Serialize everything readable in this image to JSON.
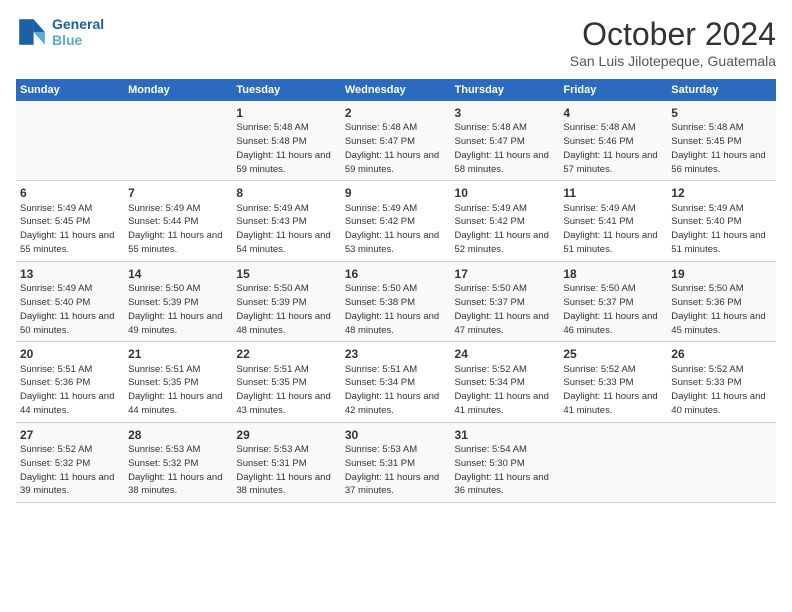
{
  "logo": {
    "line1": "General",
    "line2": "Blue"
  },
  "title": "October 2024",
  "subtitle": "San Luis Jilotepeque, Guatemala",
  "headers": [
    "Sunday",
    "Monday",
    "Tuesday",
    "Wednesday",
    "Thursday",
    "Friday",
    "Saturday"
  ],
  "weeks": [
    [
      {
        "day": "",
        "info": ""
      },
      {
        "day": "",
        "info": ""
      },
      {
        "day": "1",
        "info": "Sunrise: 5:48 AM\nSunset: 5:48 PM\nDaylight: 11 hours and 59 minutes."
      },
      {
        "day": "2",
        "info": "Sunrise: 5:48 AM\nSunset: 5:47 PM\nDaylight: 11 hours and 59 minutes."
      },
      {
        "day": "3",
        "info": "Sunrise: 5:48 AM\nSunset: 5:47 PM\nDaylight: 11 hours and 58 minutes."
      },
      {
        "day": "4",
        "info": "Sunrise: 5:48 AM\nSunset: 5:46 PM\nDaylight: 11 hours and 57 minutes."
      },
      {
        "day": "5",
        "info": "Sunrise: 5:48 AM\nSunset: 5:45 PM\nDaylight: 11 hours and 56 minutes."
      }
    ],
    [
      {
        "day": "6",
        "info": "Sunrise: 5:49 AM\nSunset: 5:45 PM\nDaylight: 11 hours and 55 minutes."
      },
      {
        "day": "7",
        "info": "Sunrise: 5:49 AM\nSunset: 5:44 PM\nDaylight: 11 hours and 55 minutes."
      },
      {
        "day": "8",
        "info": "Sunrise: 5:49 AM\nSunset: 5:43 PM\nDaylight: 11 hours and 54 minutes."
      },
      {
        "day": "9",
        "info": "Sunrise: 5:49 AM\nSunset: 5:42 PM\nDaylight: 11 hours and 53 minutes."
      },
      {
        "day": "10",
        "info": "Sunrise: 5:49 AM\nSunset: 5:42 PM\nDaylight: 11 hours and 52 minutes."
      },
      {
        "day": "11",
        "info": "Sunrise: 5:49 AM\nSunset: 5:41 PM\nDaylight: 11 hours and 51 minutes."
      },
      {
        "day": "12",
        "info": "Sunrise: 5:49 AM\nSunset: 5:40 PM\nDaylight: 11 hours and 51 minutes."
      }
    ],
    [
      {
        "day": "13",
        "info": "Sunrise: 5:49 AM\nSunset: 5:40 PM\nDaylight: 11 hours and 50 minutes."
      },
      {
        "day": "14",
        "info": "Sunrise: 5:50 AM\nSunset: 5:39 PM\nDaylight: 11 hours and 49 minutes."
      },
      {
        "day": "15",
        "info": "Sunrise: 5:50 AM\nSunset: 5:39 PM\nDaylight: 11 hours and 48 minutes."
      },
      {
        "day": "16",
        "info": "Sunrise: 5:50 AM\nSunset: 5:38 PM\nDaylight: 11 hours and 48 minutes."
      },
      {
        "day": "17",
        "info": "Sunrise: 5:50 AM\nSunset: 5:37 PM\nDaylight: 11 hours and 47 minutes."
      },
      {
        "day": "18",
        "info": "Sunrise: 5:50 AM\nSunset: 5:37 PM\nDaylight: 11 hours and 46 minutes."
      },
      {
        "day": "19",
        "info": "Sunrise: 5:50 AM\nSunset: 5:36 PM\nDaylight: 11 hours and 45 minutes."
      }
    ],
    [
      {
        "day": "20",
        "info": "Sunrise: 5:51 AM\nSunset: 5:36 PM\nDaylight: 11 hours and 44 minutes."
      },
      {
        "day": "21",
        "info": "Sunrise: 5:51 AM\nSunset: 5:35 PM\nDaylight: 11 hours and 44 minutes."
      },
      {
        "day": "22",
        "info": "Sunrise: 5:51 AM\nSunset: 5:35 PM\nDaylight: 11 hours and 43 minutes."
      },
      {
        "day": "23",
        "info": "Sunrise: 5:51 AM\nSunset: 5:34 PM\nDaylight: 11 hours and 42 minutes."
      },
      {
        "day": "24",
        "info": "Sunrise: 5:52 AM\nSunset: 5:34 PM\nDaylight: 11 hours and 41 minutes."
      },
      {
        "day": "25",
        "info": "Sunrise: 5:52 AM\nSunset: 5:33 PM\nDaylight: 11 hours and 41 minutes."
      },
      {
        "day": "26",
        "info": "Sunrise: 5:52 AM\nSunset: 5:33 PM\nDaylight: 11 hours and 40 minutes."
      }
    ],
    [
      {
        "day": "27",
        "info": "Sunrise: 5:52 AM\nSunset: 5:32 PM\nDaylight: 11 hours and 39 minutes."
      },
      {
        "day": "28",
        "info": "Sunrise: 5:53 AM\nSunset: 5:32 PM\nDaylight: 11 hours and 38 minutes."
      },
      {
        "day": "29",
        "info": "Sunrise: 5:53 AM\nSunset: 5:31 PM\nDaylight: 11 hours and 38 minutes."
      },
      {
        "day": "30",
        "info": "Sunrise: 5:53 AM\nSunset: 5:31 PM\nDaylight: 11 hours and 37 minutes."
      },
      {
        "day": "31",
        "info": "Sunrise: 5:54 AM\nSunset: 5:30 PM\nDaylight: 11 hours and 36 minutes."
      },
      {
        "day": "",
        "info": ""
      },
      {
        "day": "",
        "info": ""
      }
    ]
  ]
}
